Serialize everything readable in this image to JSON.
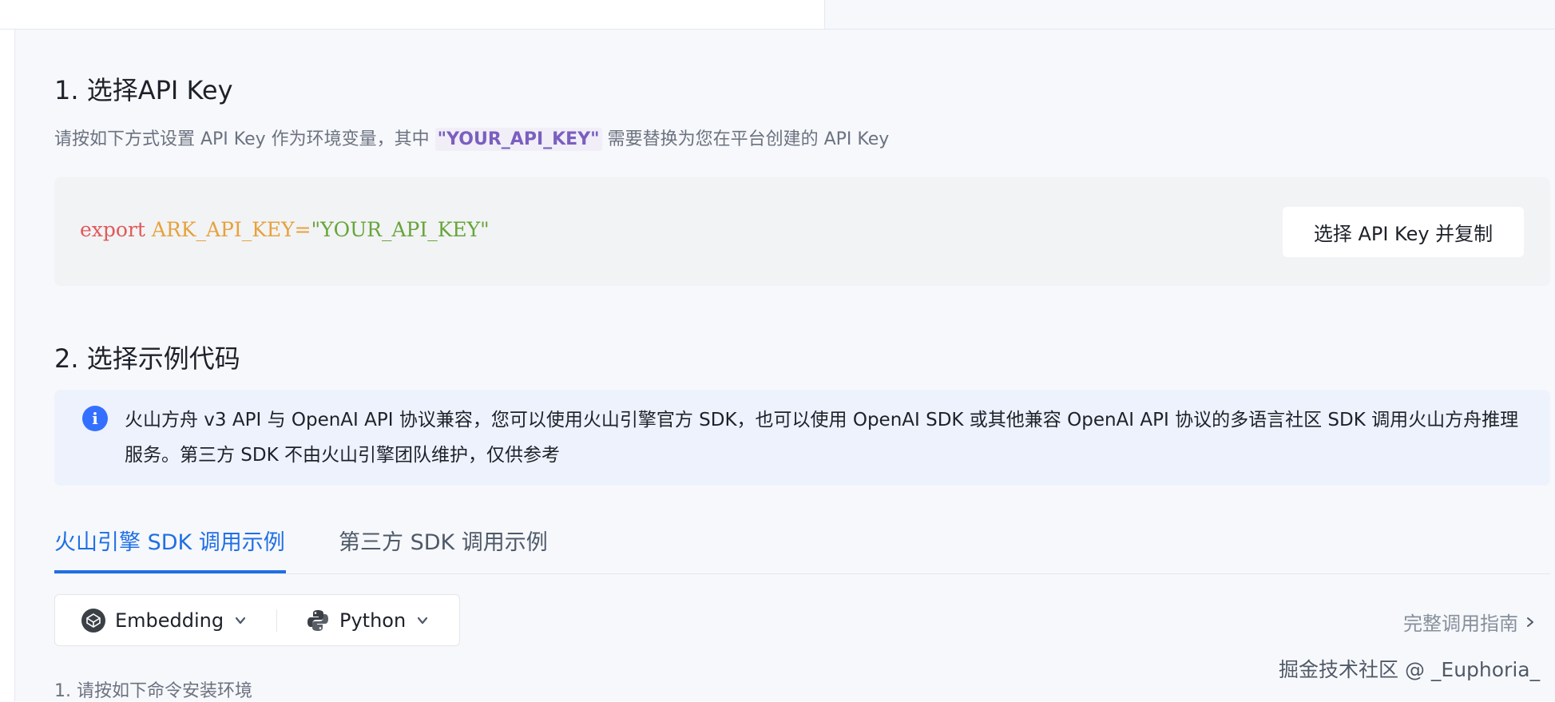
{
  "section1": {
    "title": "1. 选择API Key",
    "desc_before": "请按如下方式设置 API Key 作为环境变量，其中 ",
    "desc_key": "\"YOUR_API_KEY\"",
    "desc_after": " 需要替换为您在平台创建的 API Key",
    "code": {
      "keyword": "export",
      "variable": "ARK_API_KEY",
      "equals": "=",
      "value": "\"YOUR_API_KEY\""
    },
    "copy_button_label": "选择 API Key 并复制"
  },
  "section2": {
    "title": "2. 选择示例代码",
    "info_text": "火山方舟 v3 API 与 OpenAI API 协议兼容，您可以使用火山引擎官方 SDK，也可以使用 OpenAI SDK 或其他兼容 OpenAI API 协议的多语言社区 SDK 调用火山方舟推理服务。第三方 SDK 不由火山引擎团队维护，仅供参考",
    "info_icon": "info-icon",
    "tabs": [
      {
        "label": "火山引擎 SDK 调用示例",
        "active": true
      },
      {
        "label": "第三方 SDK 调用示例",
        "active": false
      }
    ],
    "selectors": {
      "task": {
        "label": "Embedding",
        "icon": "codepen-icon"
      },
      "language": {
        "label": "Python",
        "icon": "python-icon"
      }
    },
    "guide_link": "完整调用指南",
    "step1": "1. 请按如下命令安装环境"
  },
  "watermark": "掘金技术社区 @ _Euphoria_",
  "colors": {
    "accent": "#1f6fe5",
    "info_bg": "#eef2fc",
    "info_icon": "#3370ff",
    "code_keyword": "#e05a5a",
    "code_variable": "#e6a23c",
    "code_string": "#67a53a"
  }
}
